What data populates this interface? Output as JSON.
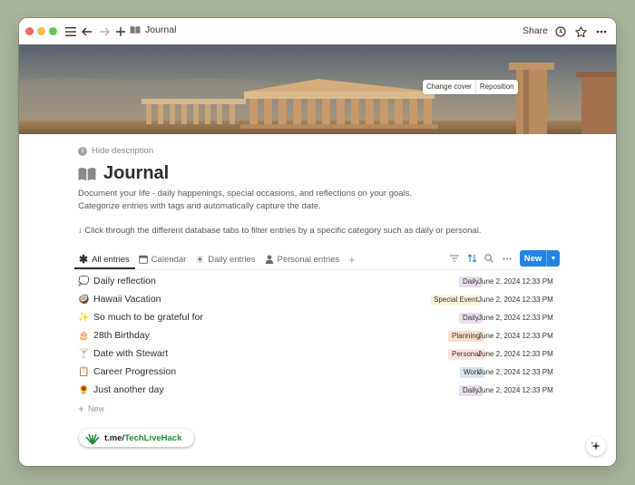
{
  "window": {
    "breadcrumb_icon": "open-book-icon",
    "breadcrumb": "Journal",
    "share_label": "Share"
  },
  "cover": {
    "change_cover": "Change cover",
    "reposition": "Reposition"
  },
  "page": {
    "hide_description": "Hide description",
    "title_icon": "open-book-icon",
    "title": "Journal",
    "description_line1": "Document your life - daily happenings, special occasions, and reflections on your goals.",
    "description_line2": "Categorize entries with tags and automatically capture the date.",
    "hint": "↓ Click through the different database tabs to filter entries by a specific category such as daily or personal."
  },
  "tabs": [
    {
      "label": "All entries",
      "icon": "asterisk-icon",
      "active": true
    },
    {
      "label": "Calendar",
      "icon": "calendar-icon",
      "active": false
    },
    {
      "label": "Daily entries",
      "icon": "sun-icon",
      "active": false
    },
    {
      "label": "Personal entries",
      "icon": "person-icon",
      "active": false
    }
  ],
  "toolbar": {
    "new_label": "New"
  },
  "rows": [
    {
      "emoji": "💭",
      "title": "Daily reflection",
      "tag": "Daily",
      "tag_color": "#e8deee",
      "date": "June 2, 2024 12:33 PM"
    },
    {
      "emoji": "🥥",
      "title": "Hawaii Vacation",
      "tag": "Special Event",
      "tag_color": "#fbf3db",
      "date": "June 2, 2024 12:33 PM"
    },
    {
      "emoji": "✨",
      "title": "So much to be grateful for",
      "tag": "Daily",
      "tag_color": "#e8deee",
      "date": "June 2, 2024 12:33 PM"
    },
    {
      "emoji": "🎂",
      "title": "28th Birthday",
      "tag": "Planning",
      "tag_color": "#fadec9",
      "date": "June 2, 2024 12:33 PM"
    },
    {
      "emoji": "🍸",
      "title": "Date with Stewart",
      "tag": "Personal",
      "tag_color": "#ffe2dd",
      "date": "June 2, 2024 12:33 PM"
    },
    {
      "emoji": "📋",
      "title": "Career Progression",
      "tag": "Work",
      "tag_color": "#d3e5ef",
      "date": "June 2, 2024 12:33 PM"
    },
    {
      "emoji": "🌻",
      "title": "Just another day",
      "tag": "Daily",
      "tag_color": "#e8deee",
      "date": "June 2, 2024 12:33 PM"
    }
  ],
  "add_row_label": "New",
  "watermark": {
    "prefix": "t.me/",
    "brand": "TechLiveHack"
  }
}
